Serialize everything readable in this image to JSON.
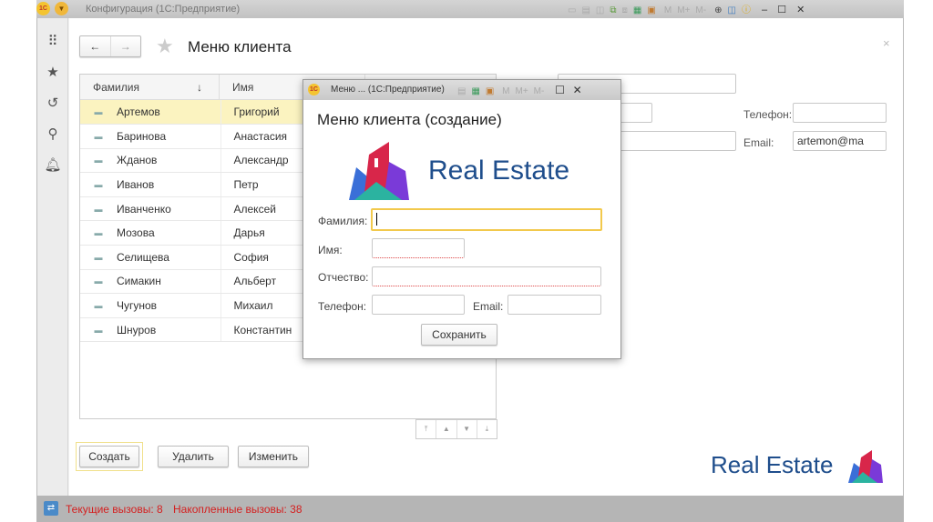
{
  "window": {
    "title": "Конфигурация  (1С:Предприятие)",
    "logo": "1С",
    "toolbar_m": [
      "M",
      "M+",
      "M-"
    ]
  },
  "page": {
    "title": "Меню клиента",
    "close": "×"
  },
  "table": {
    "headers": [
      "Фамилия",
      "Имя"
    ],
    "sort_icon": "↓",
    "rows": [
      [
        "Артемов",
        "Григорий"
      ],
      [
        "Баринова",
        "Анастасия"
      ],
      [
        "Жданов",
        "Александр"
      ],
      [
        "Иванов",
        "Петр"
      ],
      [
        "Иванченко",
        "Алексей"
      ],
      [
        "Мозова",
        "Дарья"
      ],
      [
        "Селищева",
        "София"
      ],
      [
        "Симакин",
        "Альберт"
      ],
      [
        "Чугунов",
        "Михаил"
      ],
      [
        "Шнуров",
        "Константин"
      ]
    ]
  },
  "buttons": {
    "create": "Создать",
    "delete": "Удалить",
    "edit": "Изменить"
  },
  "right_form": {
    "phone_label": "Телефон:",
    "email_label": "Email:",
    "email_value": "artemon@ma"
  },
  "brand": {
    "name": "Real Estate",
    "text_color": "#1f4e8c"
  },
  "dialog": {
    "title": "Меню ... (1С:Предприятие)",
    "heading": "Меню клиента (создание)",
    "labels": {
      "surname": "Фамилия:",
      "name": "Имя:",
      "patronymic": "Отчество:",
      "phone": "Телефон:",
      "email": "Email:"
    },
    "save": "Сохранить"
  },
  "status": {
    "current": "Текущие вызовы: 8",
    "accumulated": "Накопленные вызовы: 38"
  }
}
